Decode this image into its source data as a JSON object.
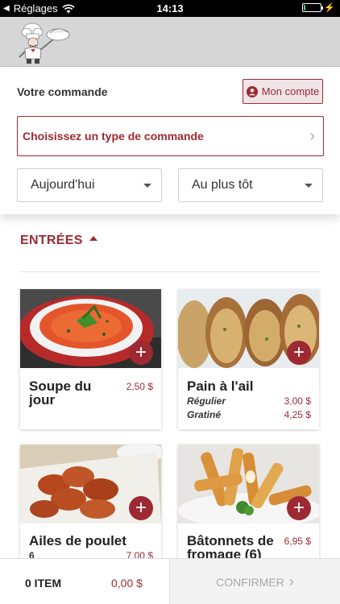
{
  "status_bar": {
    "back_label": "Réglages",
    "time": "14:13",
    "battery_level": 0.1
  },
  "order": {
    "title": "Votre commande",
    "account_label": "Mon compte",
    "order_type_label": "Choisissez un type de commande",
    "day_select": "Aujourd'hui",
    "time_select": "Au plus tôt"
  },
  "section": {
    "title": "ENTRÉES"
  },
  "products": [
    {
      "name": "Soupe du jour",
      "price": "2,50 $"
    },
    {
      "name": "Pain à l'ail",
      "options": [
        {
          "label": "Régulier",
          "price": "3,00 $"
        },
        {
          "label": "Gratiné",
          "price": "4,25 $"
        }
      ]
    },
    {
      "name": "Ailes de poulet",
      "sub": "6",
      "price": "7,00 $"
    },
    {
      "name": "Bâtonnets de fromage (6)",
      "price": "6,95 $"
    }
  ],
  "cart": {
    "items": "0 ITEM",
    "total": "0,00 $",
    "confirm_label": "CONFIRMER"
  },
  "colors": {
    "accent": "#9d2a33",
    "header_bg": "#d6d6d6"
  }
}
